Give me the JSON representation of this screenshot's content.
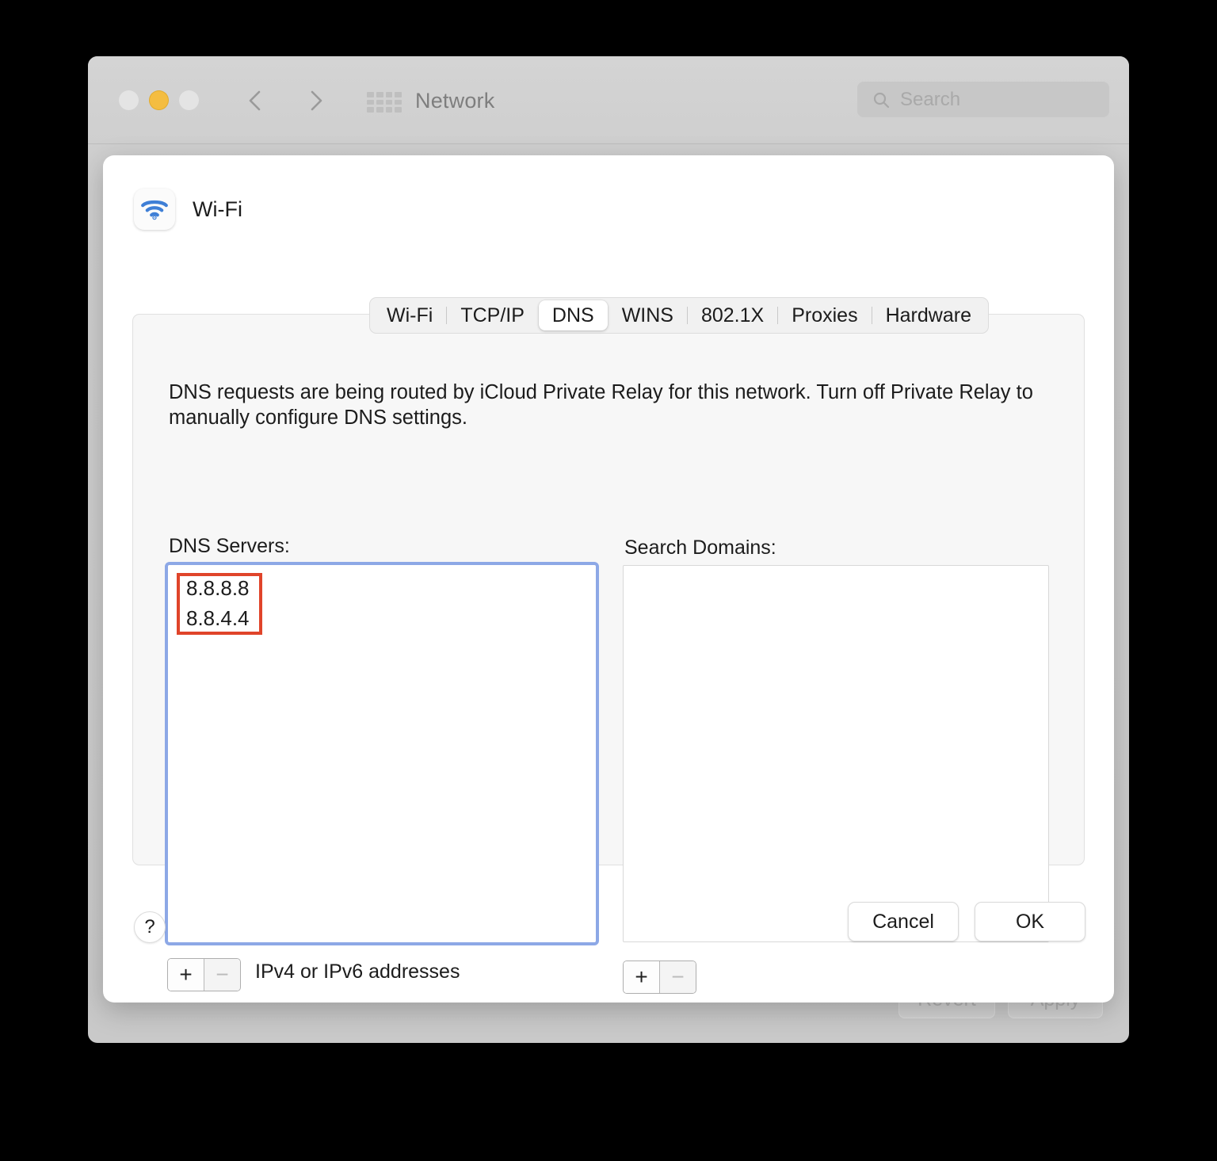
{
  "window": {
    "title": "Network",
    "traffic_lights": [
      "close-button",
      "minimize-button",
      "zoom-button"
    ],
    "search": {
      "placeholder": "Search",
      "value": ""
    },
    "footer": {
      "revert_label": "Revert",
      "apply_label": "Apply"
    }
  },
  "sheet": {
    "service_name": "Wi-Fi",
    "tabs": [
      {
        "label": "Wi-Fi",
        "selected": false
      },
      {
        "label": "TCP/IP",
        "selected": false
      },
      {
        "label": "DNS",
        "selected": true
      },
      {
        "label": "WINS",
        "selected": false
      },
      {
        "label": "802.1X",
        "selected": false
      },
      {
        "label": "Proxies",
        "selected": false
      },
      {
        "label": "Hardware",
        "selected": false
      }
    ],
    "notice": "DNS requests are being routed by iCloud Private Relay for this network. Turn off Private Relay to manually configure DNS settings.",
    "dns_servers": {
      "label": "DNS Servers:",
      "entries": [
        "8.8.8.8",
        "8.8.4.4"
      ],
      "add_label": "+",
      "remove_label": "−",
      "hint": "IPv4 or IPv6 addresses"
    },
    "search_domains": {
      "label": "Search Domains:",
      "entries": [],
      "add_label": "+",
      "remove_label": "−"
    },
    "help_label": "?",
    "cancel_label": "Cancel",
    "ok_label": "OK"
  },
  "colors": {
    "focus_ring": "#8da8e6",
    "annotation": "#e0442a",
    "wifi_icon": "#3f7fd6",
    "minimize": "#f4bd41",
    "panel_bg": "#f7f7f7"
  }
}
